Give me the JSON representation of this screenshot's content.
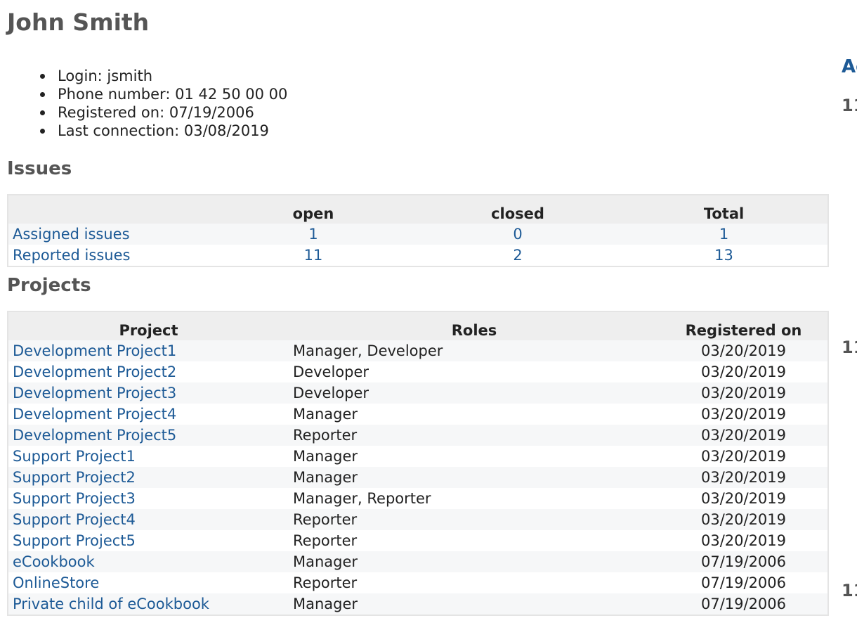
{
  "user": {
    "name": "John Smith",
    "info": [
      "Login: jsmith",
      "Phone number: 01 42 50 00 00",
      "Registered on: 07/19/2006",
      "Last connection: 03/08/2019"
    ]
  },
  "issues": {
    "title": "Issues",
    "headers": [
      "",
      "open",
      "closed",
      "Total"
    ],
    "rows": [
      {
        "label": "Assigned issues",
        "open": "1",
        "closed": "0",
        "total": "1"
      },
      {
        "label": "Reported issues",
        "open": "11",
        "closed": "2",
        "total": "13"
      }
    ]
  },
  "projects": {
    "title": "Projects",
    "headers": [
      "Project",
      "Roles",
      "Registered on"
    ],
    "rows": [
      {
        "project": "Development Project1",
        "roles": "Manager, Developer",
        "registered": "03/20/2019"
      },
      {
        "project": "Development Project2",
        "roles": "Developer",
        "registered": "03/20/2019"
      },
      {
        "project": "Development Project3",
        "roles": "Developer",
        "registered": "03/20/2019"
      },
      {
        "project": "Development Project4",
        "roles": "Manager",
        "registered": "03/20/2019"
      },
      {
        "project": "Development Project5",
        "roles": "Reporter",
        "registered": "03/20/2019"
      },
      {
        "project": "Support Project1",
        "roles": "Manager",
        "registered": "03/20/2019"
      },
      {
        "project": "Support Project2",
        "roles": "Manager",
        "registered": "03/20/2019"
      },
      {
        "project": "Support Project3",
        "roles": "Manager, Reporter",
        "registered": "03/20/2019"
      },
      {
        "project": "Support Project4",
        "roles": "Reporter",
        "registered": "03/20/2019"
      },
      {
        "project": "Support Project5",
        "roles": "Reporter",
        "registered": "03/20/2019"
      },
      {
        "project": "eCookbook",
        "roles": "Manager",
        "registered": "07/19/2006"
      },
      {
        "project": "OnlineStore",
        "roles": "Reporter",
        "registered": "07/19/2006"
      },
      {
        "project": "Private child of eCookbook",
        "roles": "Manager",
        "registered": "07/19/2006"
      }
    ]
  },
  "sidebar": {
    "activity_title": "Ac",
    "day_labels": [
      "11",
      "11",
      "11"
    ]
  },
  "colors": {
    "link": "#1d5a96",
    "heading": "#555555",
    "header_bg": "#eeeeee",
    "odd_row_bg": "#f6f7f8"
  }
}
